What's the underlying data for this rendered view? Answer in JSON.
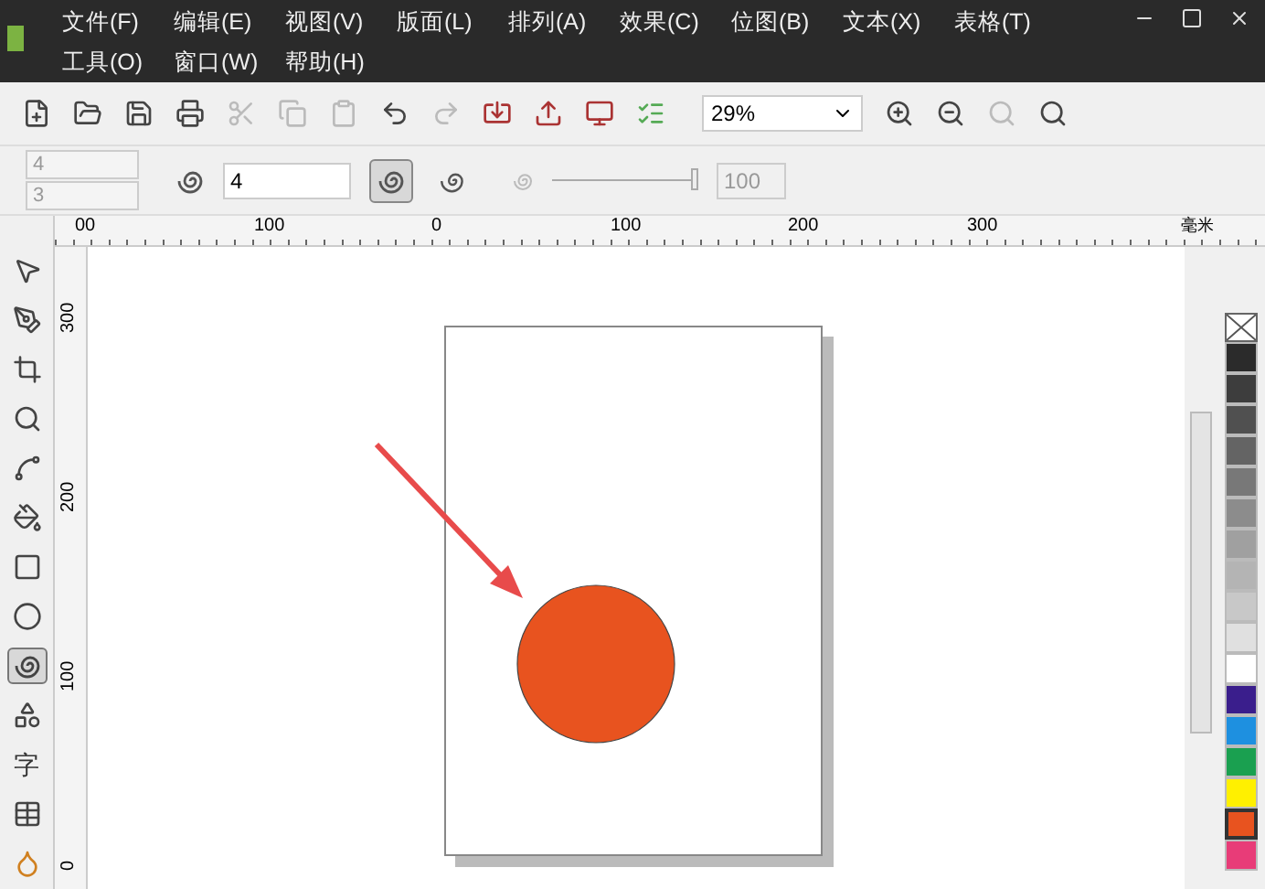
{
  "menu_bar": {
    "rows": [
      [
        "文件(F)",
        "编辑(E)",
        "视图(V)",
        "版面(L)",
        "排列(A)",
        "效果(C)",
        "位图(B)",
        "文本(X)",
        "表格(T)"
      ],
      [
        "工具(O)",
        "窗口(W)",
        "帮助(H)"
      ]
    ]
  },
  "toolbar": {
    "zoom": "29%"
  },
  "property_bar": {
    "columns": "4",
    "rows": "3",
    "revolutions": "4",
    "expansion": "100",
    "expansion_slider": {
      "level": 1
    },
    "spiral_types": [
      {
        "kind": "symmetric",
        "selected": true
      },
      {
        "kind": "logarithmic",
        "selected": false
      }
    ]
  },
  "horizontal_ruler": {
    "labels": [
      "00",
      "100",
      "0",
      "100",
      "200",
      "300"
    ],
    "unit": "毫米"
  },
  "vertical_ruler": {
    "labels": [
      "300",
      "200",
      "100",
      "0"
    ]
  },
  "toolbox": {
    "tools": [
      {
        "kind": "pointer",
        "selected": false
      },
      {
        "kind": "shape",
        "selected": false
      },
      {
        "kind": "crop",
        "selected": false
      },
      {
        "kind": "zoom",
        "selected": false
      },
      {
        "kind": "freehand",
        "selected": false
      },
      {
        "kind": "smart-fill",
        "selected": false
      },
      {
        "kind": "rectangle",
        "selected": false
      },
      {
        "kind": "ellipse",
        "selected": false
      },
      {
        "kind": "spiral",
        "selected": true
      },
      {
        "kind": "shapes",
        "selected": false
      },
      {
        "kind": "text",
        "label": "字",
        "selected": false
      },
      {
        "kind": "table",
        "selected": false
      },
      {
        "kind": "fill",
        "selected": false
      }
    ]
  },
  "palette": [
    {
      "kind": "none",
      "selected": false
    },
    {
      "color": "#2b2b2b",
      "selected": false
    },
    {
      "color": "#3d3d3d",
      "selected": false
    },
    {
      "color": "#505050",
      "selected": false
    },
    {
      "color": "#646464",
      "selected": false
    },
    {
      "color": "#787878",
      "selected": false
    },
    {
      "color": "#8c8c8c",
      "selected": false
    },
    {
      "color": "#a0a0a0",
      "selected": false
    },
    {
      "color": "#b4b4b4",
      "selected": false
    },
    {
      "color": "#c8c8c8",
      "selected": false
    },
    {
      "color": "#e0e0e0",
      "selected": false
    },
    {
      "color": "#ffffff",
      "selected": false
    },
    {
      "color": "#3a1e8c",
      "selected": false
    },
    {
      "color": "#1e90e0",
      "selected": false
    },
    {
      "color": "#1aa050",
      "selected": false
    },
    {
      "color": "#fff000",
      "selected": false
    },
    {
      "color": "#e8531f",
      "selected": true
    },
    {
      "color": "#e83c78",
      "selected": false
    }
  ]
}
